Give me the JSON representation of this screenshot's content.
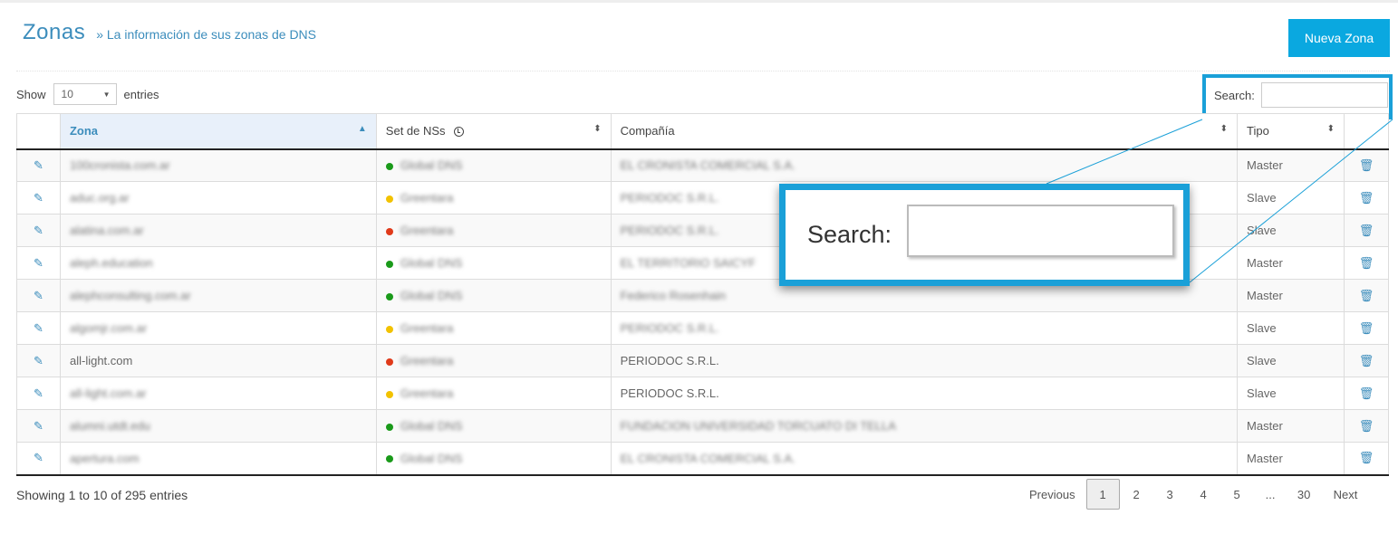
{
  "header": {
    "title": "Zonas",
    "subtitle": "» La información de sus zonas de DNS",
    "new_button": "Nueva Zona"
  },
  "length_menu": {
    "prefix": "Show",
    "value": "10",
    "suffix": "entries"
  },
  "search": {
    "label": "Search:",
    "value": ""
  },
  "zoom": {
    "label": "Search:"
  },
  "table": {
    "columns": [
      "Zona",
      "Set de NSs",
      "Compañía",
      "Tipo"
    ],
    "rows": [
      {
        "zona": "100cronista.com.ar",
        "ns": "Global DNS",
        "ns_color": "#1a9a1a",
        "compania": "EL CRONISTA COMERCIAL S.A.",
        "tipo": "Master"
      },
      {
        "zona": "aduc.org.ar",
        "ns": "Greentara",
        "ns_color": "#f2c200",
        "compania": "PERIODOC S.R.L.",
        "tipo": "Slave"
      },
      {
        "zona": "alatina.com.ar",
        "ns": "Greentara",
        "ns_color": "#e03a1a",
        "compania": "PERIODOC S.R.L.",
        "tipo": "Slave"
      },
      {
        "zona": "aleph.education",
        "ns": "Global DNS",
        "ns_color": "#1a9a1a",
        "compania": "EL TERRITORIO SAICYF",
        "tipo": "Master"
      },
      {
        "zona": "alephconsulting.com.ar",
        "ns": "Global DNS",
        "ns_color": "#1a9a1a",
        "compania": "Federico Rosenhain",
        "tipo": "Master"
      },
      {
        "zona": "algomjr.com.ar",
        "ns": "Greentara",
        "ns_color": "#f2c200",
        "compania": "PERIODOC S.R.L.",
        "tipo": "Slave"
      },
      {
        "zona": "all-light.com",
        "ns": "Greentara",
        "ns_color": "#e03a1a",
        "compania": "PERIODOC S.R.L.",
        "tipo": "Slave"
      },
      {
        "zona": "all-light.com.ar",
        "ns": "Greentara",
        "ns_color": "#f2c200",
        "compania": "PERIODOC S.R.L.",
        "tipo": "Slave"
      },
      {
        "zona": "alumni.utdt.edu",
        "ns": "Global DNS",
        "ns_color": "#1a9a1a",
        "compania": "FUNDACION UNIVERSIDAD TORCUATO DI TELLA",
        "tipo": "Master"
      },
      {
        "zona": "apertura.com",
        "ns": "Global DNS",
        "ns_color": "#1a9a1a",
        "compania": "EL CRONISTA COMERCIAL S.A.",
        "tipo": "Master"
      }
    ]
  },
  "footer": {
    "info": "Showing 1 to 10 of 295 entries",
    "pages": [
      "Previous",
      "1",
      "2",
      "3",
      "4",
      "5",
      "...",
      "30",
      "Next"
    ],
    "active_page": "1"
  },
  "colors": {
    "accent": "#0aa8e0",
    "highlight": "#1aa0d8",
    "link": "#3c8dbc"
  }
}
